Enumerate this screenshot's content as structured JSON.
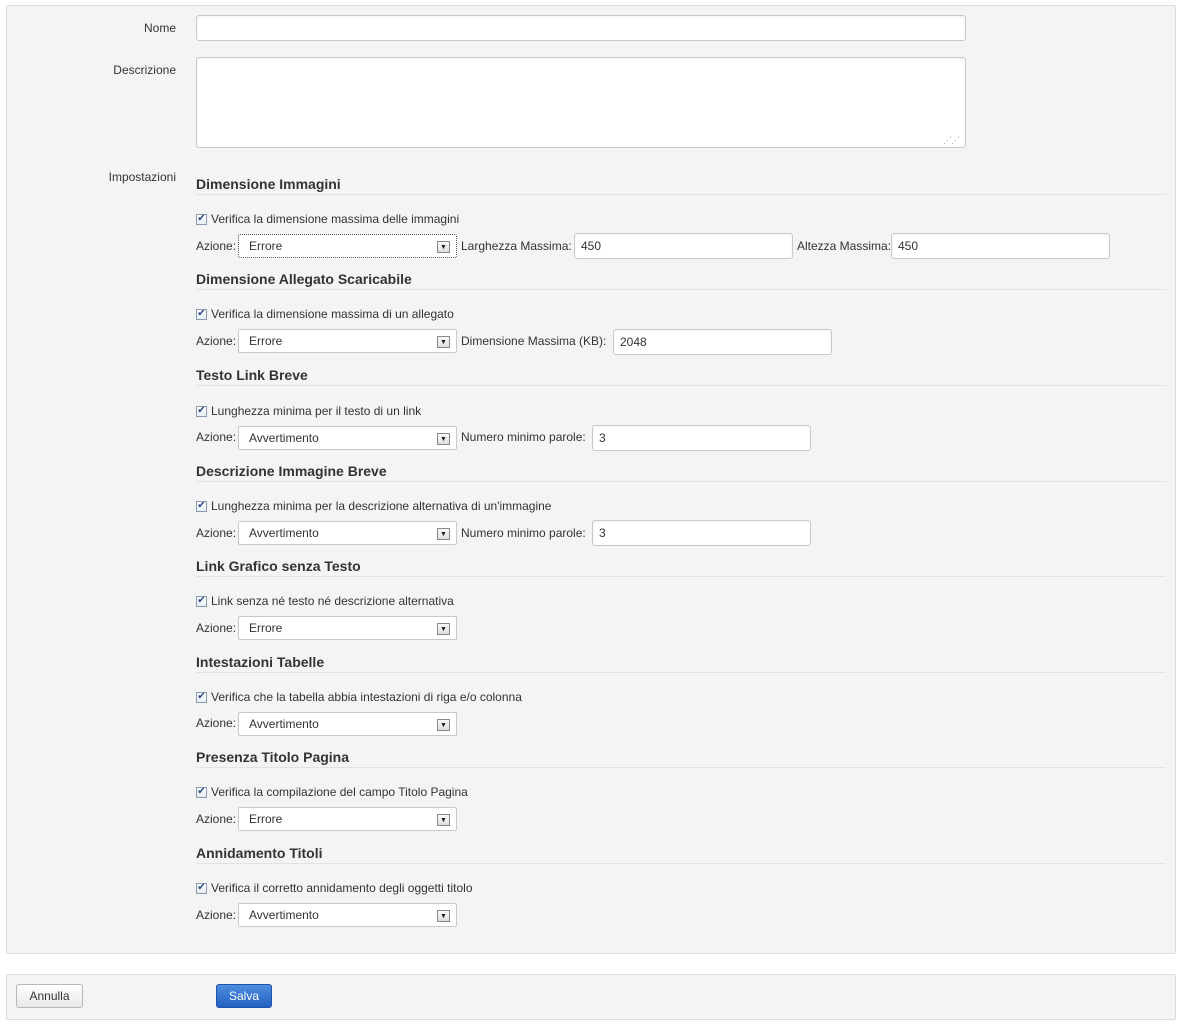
{
  "form": {
    "name_label": "Nome",
    "name_value": "",
    "description_label": "Descrizione",
    "description_value": "",
    "settings_label": "Impostazioni"
  },
  "sections": [
    {
      "title": "Dimensione Immagini",
      "checkbox_label": "Verifica la dimensione massima delle immagini",
      "checked": true,
      "action_label": "Azione:",
      "action_value": "Errore",
      "fields": [
        {
          "label": "Larghezza Massima:",
          "value": "450"
        },
        {
          "label": "Altezza Massima:",
          "value": "450"
        }
      ]
    },
    {
      "title": "Dimensione Allegato Scaricabile",
      "checkbox_label": "Verifica la dimensione massima di un allegato",
      "checked": true,
      "action_label": "Azione:",
      "action_value": "Errore",
      "fields": [
        {
          "label": "Dimensione Massima (KB):",
          "value": "2048"
        }
      ]
    },
    {
      "title": "Testo Link Breve",
      "checkbox_label": "Lunghezza minima per il testo di un link",
      "checked": true,
      "action_label": "Azione:",
      "action_value": "Avvertimento",
      "fields": [
        {
          "label": "Numero minimo parole:",
          "value": "3"
        }
      ]
    },
    {
      "title": "Descrizione Immagine Breve",
      "checkbox_label": "Lunghezza minima per la descrizione alternativa di un'immagine",
      "checked": true,
      "action_label": "Azione:",
      "action_value": "Avvertimento",
      "fields": [
        {
          "label": "Numero minimo parole:",
          "value": "3"
        }
      ]
    },
    {
      "title": "Link Grafico senza Testo",
      "checkbox_label": "Link senza né testo né descrizione alternativa",
      "checked": true,
      "action_label": "Azione:",
      "action_value": "Errore",
      "fields": []
    },
    {
      "title": "Intestazioni Tabelle",
      "checkbox_label": "Verifica che la tabella abbia intestazioni di riga e/o colonna",
      "checked": true,
      "action_label": "Azione:",
      "action_value": "Avvertimento",
      "fields": []
    },
    {
      "title": "Presenza Titolo Pagina",
      "checkbox_label": "Verifica la compilazione del campo Titolo Pagina",
      "checked": true,
      "action_label": "Azione:",
      "action_value": "Errore",
      "fields": []
    },
    {
      "title": "Annidamento Titoli",
      "checkbox_label": "Verifica il corretto annidamento degli oggetti titolo",
      "checked": true,
      "action_label": "Azione:",
      "action_value": "Avvertimento",
      "fields": []
    }
  ],
  "footer": {
    "cancel_label": "Annulla",
    "save_label": "Salva"
  },
  "icons": {
    "checkbox_check": "checkmark-icon",
    "select_arrow": "chevron-down-icon",
    "resize_grip": "resize-grip-icon"
  },
  "colors": {
    "panel_bg": "#f4f4f4",
    "primary_button": "#2a6ccf",
    "border": "#c9c9c9"
  }
}
